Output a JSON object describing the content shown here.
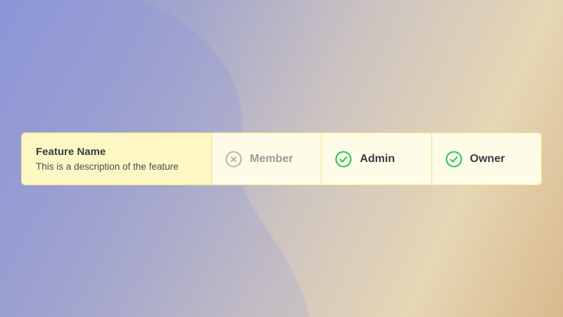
{
  "feature": {
    "name": "Feature Name",
    "description": "This is a description of the feature"
  },
  "roles": [
    {
      "label": "Member",
      "access": "denied",
      "icon": "x-circle-icon"
    },
    {
      "label": "Admin",
      "access": "granted",
      "icon": "check-circle-icon"
    },
    {
      "label": "Owner",
      "access": "granted",
      "icon": "check-circle-icon"
    }
  ],
  "colors": {
    "granted": "#22c55e",
    "denied": "#b5b5b2",
    "highlight": "#fdf7c3",
    "border": "#f1e38a"
  }
}
